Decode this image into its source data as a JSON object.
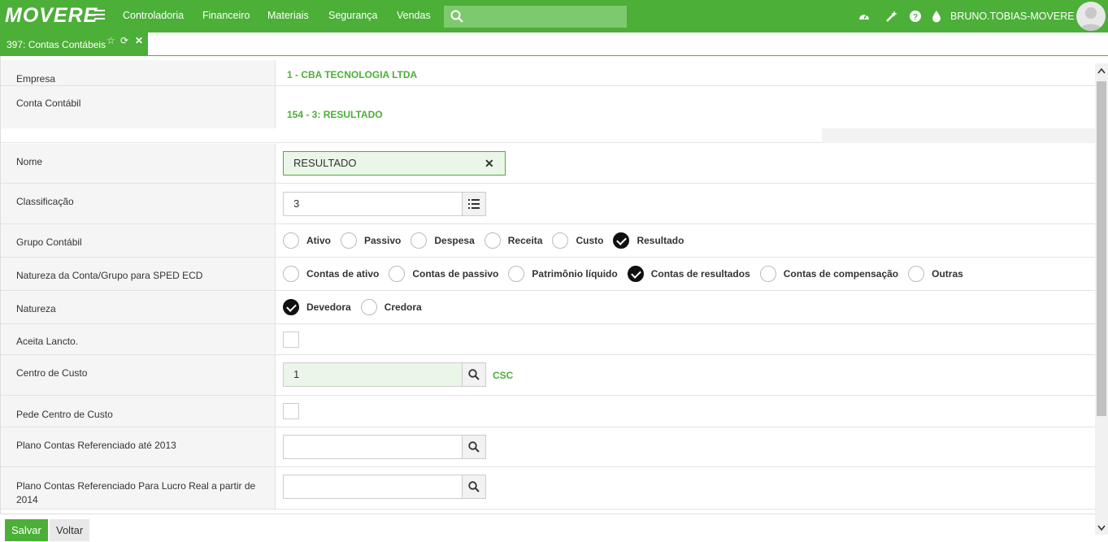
{
  "app": {
    "logo": "MOVERE"
  },
  "menu": [
    "Controladoria",
    "Financeiro",
    "Materiais",
    "Segurança",
    "Vendas"
  ],
  "search": {
    "placeholder": ""
  },
  "user": {
    "name": "BRUNO.TOBIAS-MOVERE"
  },
  "tab": {
    "title": "397: Contas Contábeis"
  },
  "colors": {
    "brand": "#4caf38",
    "selected_input": "#eaf6e8"
  },
  "fields": {
    "empresa": {
      "label": "Empresa",
      "value": "1 - CBA TECNOLOGIA LTDA"
    },
    "conta": {
      "label": "Conta Contábil",
      "value": "154 - 3: RESULTADO"
    },
    "nome": {
      "label": "Nome",
      "value": "RESULTADO"
    },
    "classificacao": {
      "label": "Classificação",
      "value": "3"
    },
    "grupo": {
      "label": "Grupo Contábil",
      "options": [
        "Ativo",
        "Passivo",
        "Despesa",
        "Receita",
        "Custo",
        "Resultado"
      ],
      "selected": "Resultado"
    },
    "natureza_sped": {
      "label": "Natureza da Conta/Grupo para SPED ECD",
      "options": [
        "Contas de ativo",
        "Contas de passivo",
        "Patrimônio líquido",
        "Contas de resultados",
        "Contas de compensação",
        "Outras"
      ],
      "selected": "Contas de resultados"
    },
    "natureza": {
      "label": "Natureza",
      "options": [
        "Devedora",
        "Credora"
      ],
      "selected": "Devedora"
    },
    "aceita": {
      "label": "Aceita Lancto.",
      "checked": false
    },
    "centro": {
      "label": "Centro de Custo",
      "value": "1",
      "desc": "CSC"
    },
    "pede_centro": {
      "label": "Pede Centro de Custo",
      "checked": false
    },
    "plano2013": {
      "label": "Plano Contas Referenciado até 2013",
      "value": ""
    },
    "plano2014": {
      "label": "Plano Contas Referenciado Para Lucro Real a partir de 2014",
      "value": ""
    }
  },
  "footer": {
    "save": "Salvar",
    "back": "Voltar"
  }
}
